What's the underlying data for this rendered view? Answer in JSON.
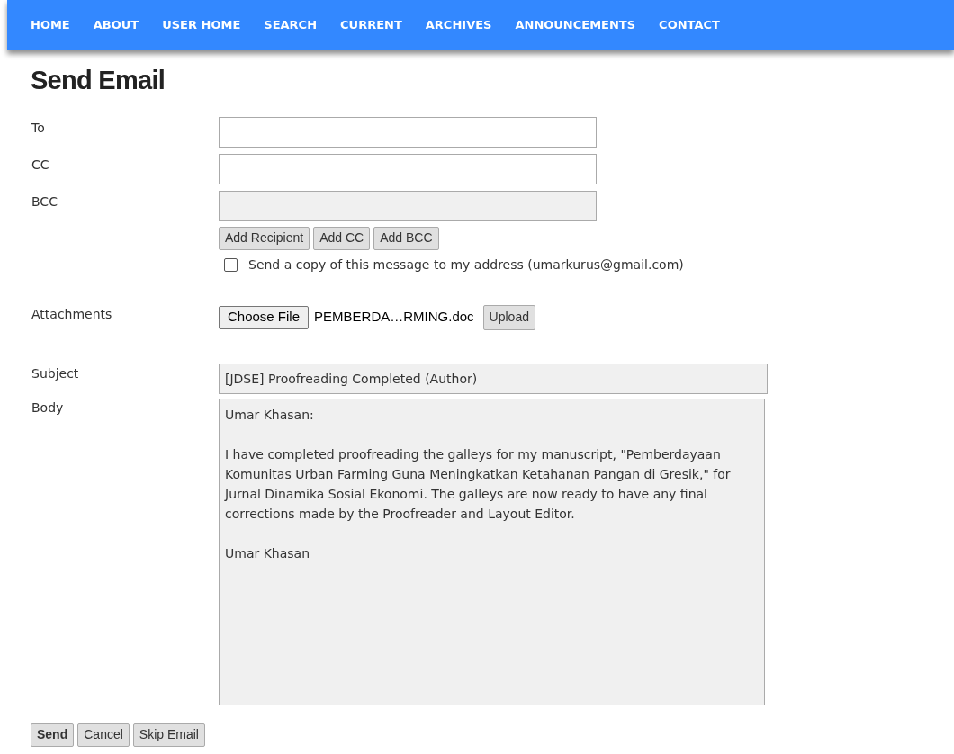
{
  "nav": [
    {
      "label": "HOME"
    },
    {
      "label": "ABOUT"
    },
    {
      "label": "USER HOME"
    },
    {
      "label": "SEARCH"
    },
    {
      "label": "CURRENT"
    },
    {
      "label": "ARCHIVES"
    },
    {
      "label": "ANNOUNCEMENTS"
    },
    {
      "label": "CONTACT"
    }
  ],
  "title": "Send Email",
  "recipients": [
    {
      "label": "To"
    },
    {
      "label": "CC"
    },
    {
      "label": "BCC"
    }
  ],
  "recipient_buttons": [
    "Add Recipient",
    "Add CC",
    "Add BCC"
  ],
  "copy_option": {
    "label": "Send a copy of this message to my address (umarkurus@gmail.com)",
    "checked": false
  },
  "attachments": {
    "label": "Attachments",
    "choose_button": "Choose File",
    "file_name": "PEMBERDA…RMING.doc",
    "upload_button": "Upload"
  },
  "subject": {
    "label": "Subject",
    "value": "[JDSE] Proofreading Completed (Author)"
  },
  "body": {
    "label": "Body",
    "value": "Umar Khasan:\n\nI have completed proofreading the galleys for my manuscript, \"Pemberdayaan Komunitas Urban Farming Guna Meningkatkan Ketahanan Pangan di Gresik,\" for Jurnal Dinamika Sosial Ekonomi. The galleys are now ready to have any final corrections made by the Proofreader and Layout Editor.\n\nUmar Khasan"
  },
  "actions": [
    {
      "label": "Send",
      "primary": true
    },
    {
      "label": "Cancel",
      "primary": false
    },
    {
      "label": "Skip Email",
      "primary": false
    }
  ]
}
